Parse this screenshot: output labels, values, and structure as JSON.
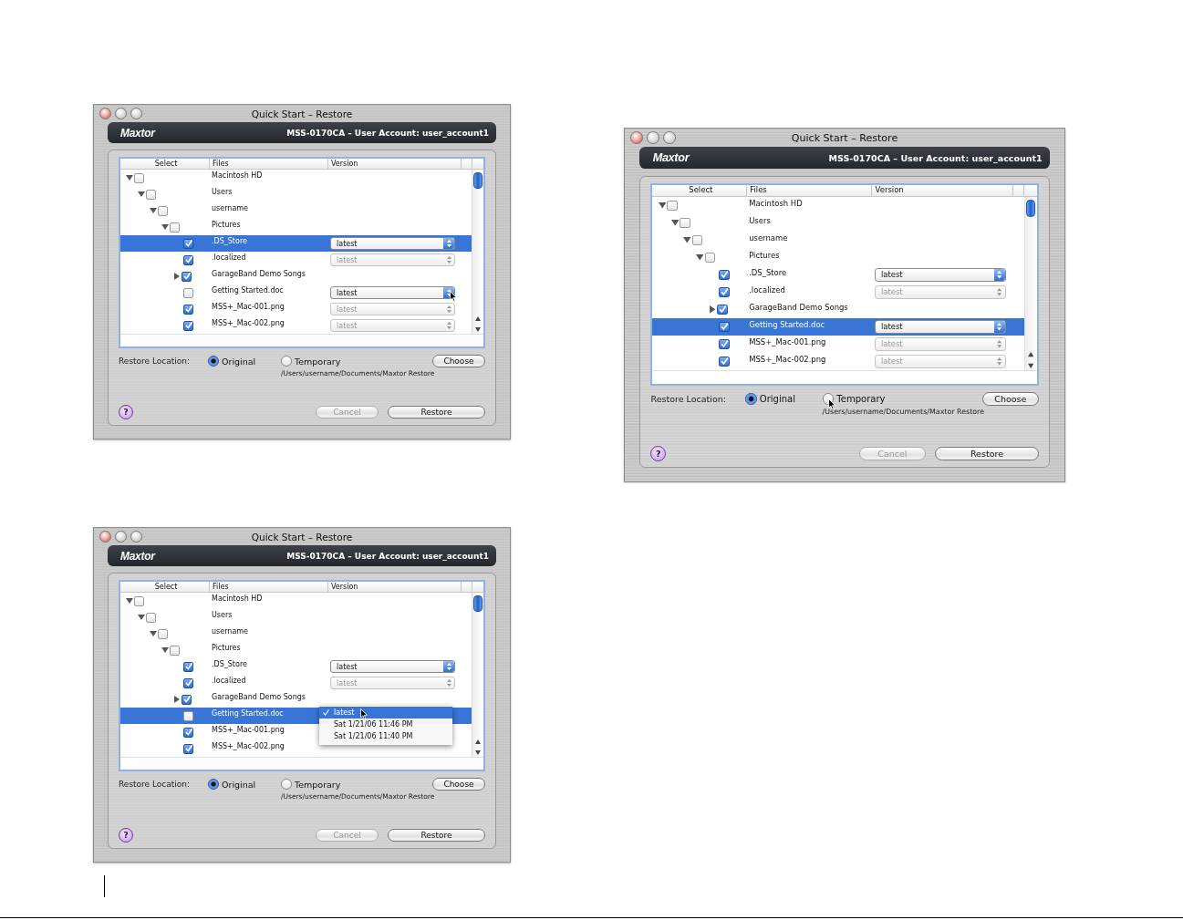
{
  "windows": [
    {
      "title": "Quick Start – Restore",
      "brand": "Maxtor",
      "account": "MSS-0170CA – User Account: user_account1",
      "columns": [
        "Select",
        "Files",
        "Version"
      ],
      "tree": [
        {
          "name": "Macintosh HD",
          "checked": false,
          "selected": false,
          "expanded": true,
          "children": [
            {
              "name": "Users",
              "checked": false,
              "selected": false,
              "expanded": true,
              "children": [
                {
                  "name": "username",
                  "checked": false,
                  "selected": false,
                  "expanded": true,
                  "children": [
                    {
                      "name": "Pictures",
                      "checked": false,
                      "selected": false,
                      "expanded": true,
                      "children": [
                        {
                          "name": ".DS_Store",
                          "checked": true,
                          "selected": true,
                          "version": {
                            "value": "latest",
                            "enabled": true,
                            "hovered": false
                          }
                        },
                        {
                          "name": ".localized",
                          "checked": true,
                          "selected": false,
                          "version": {
                            "value": "latest",
                            "enabled": false,
                            "hovered": false
                          }
                        },
                        {
                          "name": "GarageBand Demo Songs",
                          "checked": true,
                          "selected": false,
                          "expanded": false
                        },
                        {
                          "name": "Getting Started.doc",
                          "checked": false,
                          "selected": false,
                          "version": {
                            "value": "latest",
                            "enabled": true,
                            "hovered": true
                          }
                        },
                        {
                          "name": "MSS+_Mac-001.png",
                          "checked": true,
                          "selected": false,
                          "version": {
                            "value": "latest",
                            "enabled": false,
                            "hovered": false
                          }
                        },
                        {
                          "name": "MSS+_Mac-002.png",
                          "checked": true,
                          "selected": false,
                          "version": {
                            "value": "latest",
                            "enabled": false,
                            "hovered": false
                          }
                        }
                      ]
                    }
                  ]
                }
              ]
            }
          ]
        }
      ],
      "restore_label": "Restore Location:",
      "options": [
        {
          "label": "Original",
          "selected": true,
          "hovered": false
        },
        {
          "label": "Temporary",
          "selected": false,
          "hovered": false
        }
      ],
      "choose": "Choose",
      "path": "/Users/username/Documents/Maxtor Restore",
      "buttons": [
        {
          "label": "Cancel",
          "disabled": true
        },
        {
          "label": "Restore",
          "disabled": false
        }
      ],
      "help": "?"
    },
    {
      "title": "Quick Start – Restore",
      "brand": "Maxtor",
      "account": "MSS-0170CA – User Account: user_account1",
      "columns": [
        "Select",
        "Files",
        "Version"
      ],
      "tree": [
        {
          "name": "Macintosh HD",
          "checked": false,
          "selected": false,
          "expanded": true,
          "children": [
            {
              "name": "Users",
              "checked": false,
              "selected": false,
              "expanded": true,
              "children": [
                {
                  "name": "username",
                  "checked": false,
                  "selected": false,
                  "expanded": true,
                  "children": [
                    {
                      "name": "Pictures",
                      "checked": false,
                      "selected": false,
                      "expanded": true,
                      "children": [
                        {
                          "name": ".DS_Store",
                          "checked": true,
                          "selected": false,
                          "version": {
                            "value": "latest",
                            "enabled": true,
                            "hovered": false
                          }
                        },
                        {
                          "name": ".localized",
                          "checked": true,
                          "selected": false,
                          "version": {
                            "value": "latest",
                            "enabled": false,
                            "hovered": false
                          }
                        },
                        {
                          "name": "GarageBand Demo Songs",
                          "checked": true,
                          "selected": false,
                          "expanded": false
                        },
                        {
                          "name": "Getting Started.doc",
                          "checked": false,
                          "selected": true,
                          "menu": [
                            {
                              "label": "latest",
                              "selected": true,
                              "hovered": true
                            },
                            {
                              "label": "Sat 1/21/06 11:46 PM",
                              "selected": false,
                              "hovered": false
                            },
                            {
                              "label": "Sat 1/21/06 11:40 PM",
                              "selected": false,
                              "hovered": false
                            }
                          ]
                        },
                        {
                          "name": "MSS+_Mac-001.png",
                          "checked": true,
                          "selected": false
                        },
                        {
                          "name": "MSS+_Mac-002.png",
                          "checked": true,
                          "selected": false
                        }
                      ]
                    }
                  ]
                }
              ]
            }
          ]
        }
      ],
      "restore_label": "Restore Location:",
      "options": [
        {
          "label": "Original",
          "selected": true,
          "hovered": false
        },
        {
          "label": "Temporary",
          "selected": false,
          "hovered": false
        }
      ],
      "choose": "Choose",
      "path": "/Users/username/Documents/Maxtor Restore",
      "buttons": [
        {
          "label": "Cancel",
          "disabled": true
        },
        {
          "label": "Restore",
          "disabled": false
        }
      ],
      "help": "?"
    },
    {
      "title": "Quick Start – Restore",
      "brand": "Maxtor",
      "account": "MSS-0170CA – User Account: user_account1",
      "columns": [
        "Select",
        "Files",
        "Version"
      ],
      "tree": [
        {
          "name": "Macintosh HD",
          "checked": false,
          "selected": false,
          "expanded": true,
          "children": [
            {
              "name": "Users",
              "checked": false,
              "selected": false,
              "expanded": true,
              "children": [
                {
                  "name": "username",
                  "checked": false,
                  "selected": false,
                  "expanded": true,
                  "children": [
                    {
                      "name": "Pictures",
                      "checked": false,
                      "selected": false,
                      "expanded": true,
                      "children": [
                        {
                          "name": ".DS_Store",
                          "checked": true,
                          "selected": false,
                          "version": {
                            "value": "latest",
                            "enabled": true,
                            "hovered": false
                          }
                        },
                        {
                          "name": ".localized",
                          "checked": true,
                          "selected": false,
                          "version": {
                            "value": "latest",
                            "enabled": false,
                            "hovered": false
                          }
                        },
                        {
                          "name": "GarageBand Demo Songs",
                          "checked": true,
                          "selected": false,
                          "expanded": false
                        },
                        {
                          "name": "Getting Started.doc",
                          "checked": true,
                          "selected": true,
                          "version": {
                            "value": "latest",
                            "enabled": true,
                            "hovered": false
                          }
                        },
                        {
                          "name": "MSS+_Mac-001.png",
                          "checked": true,
                          "selected": false,
                          "version": {
                            "value": "latest",
                            "enabled": false,
                            "hovered": false
                          }
                        },
                        {
                          "name": "MSS+_Mac-002.png",
                          "checked": true,
                          "selected": false,
                          "version": {
                            "value": "latest",
                            "enabled": false,
                            "hovered": false
                          }
                        }
                      ]
                    }
                  ]
                }
              ]
            }
          ]
        }
      ],
      "restore_label": "Restore Location:",
      "options": [
        {
          "label": "Original",
          "selected": true,
          "hovered": false
        },
        {
          "label": "Temporary",
          "selected": false,
          "hovered": true
        }
      ],
      "choose": "Choose",
      "path": "/Users/username/Documents/Maxtor Restore",
      "buttons": [
        {
          "label": "Cancel",
          "disabled": true
        },
        {
          "label": "Restore",
          "disabled": false
        }
      ],
      "help": "?"
    }
  ]
}
